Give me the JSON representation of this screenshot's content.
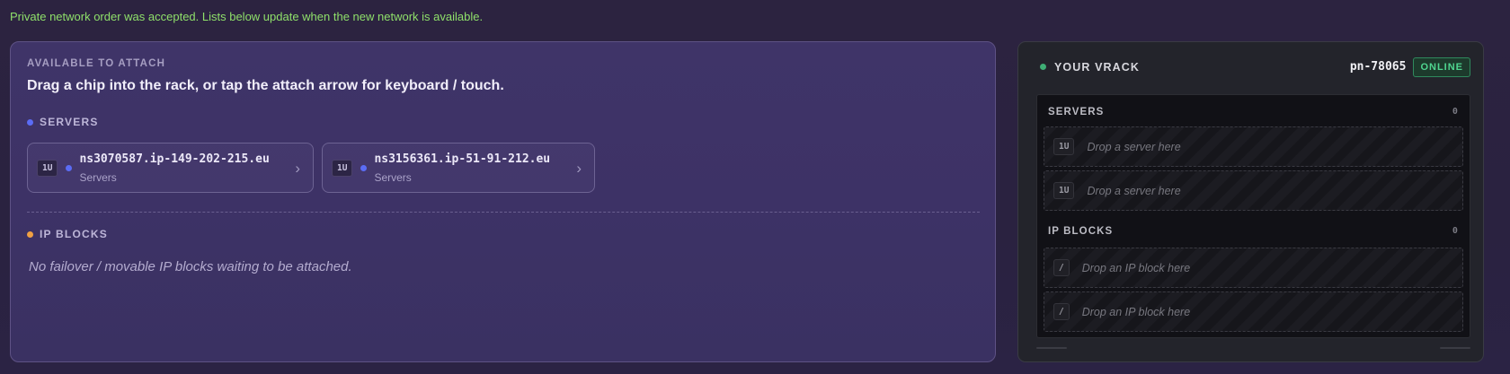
{
  "notice": "Private network order was accepted. Lists below update when the new network is available.",
  "available": {
    "eyebrow": "AVAILABLE TO ATTACH",
    "headline": "Drag a chip into the rack, or tap the attach arrow for keyboard / touch.",
    "servers_label": "SERVERS",
    "servers": [
      {
        "size": "1U",
        "name": "ns3070587.ip-149-202-215.eu",
        "type": "Servers",
        "arrow": "›"
      },
      {
        "size": "1U",
        "name": "ns3156361.ip-51-91-212.eu",
        "type": "Servers",
        "arrow": "›"
      }
    ],
    "ip_label": "IP BLOCKS",
    "ip_empty": "No failover / movable IP blocks waiting to be attached."
  },
  "rack": {
    "title": "YOUR VRACK",
    "id": "pn-78065",
    "status": "ONLINE",
    "servers_label": "SERVERS",
    "servers_count": "0",
    "server_slots": [
      {
        "badge": "1U",
        "text": "Drop a server here"
      },
      {
        "badge": "1U",
        "text": "Drop a server here"
      }
    ],
    "ip_label": "IP BLOCKS",
    "ip_count": "0",
    "ip_slots": [
      {
        "badge": "/",
        "text": "Drop an IP block here"
      },
      {
        "badge": "/",
        "text": "Drop an IP block here"
      }
    ]
  },
  "colors": {
    "accent_green": "#8fe06a",
    "online_green": "#4fd58f",
    "server_dot": "#5b6cf5",
    "ip_dot": "#f0a043"
  }
}
